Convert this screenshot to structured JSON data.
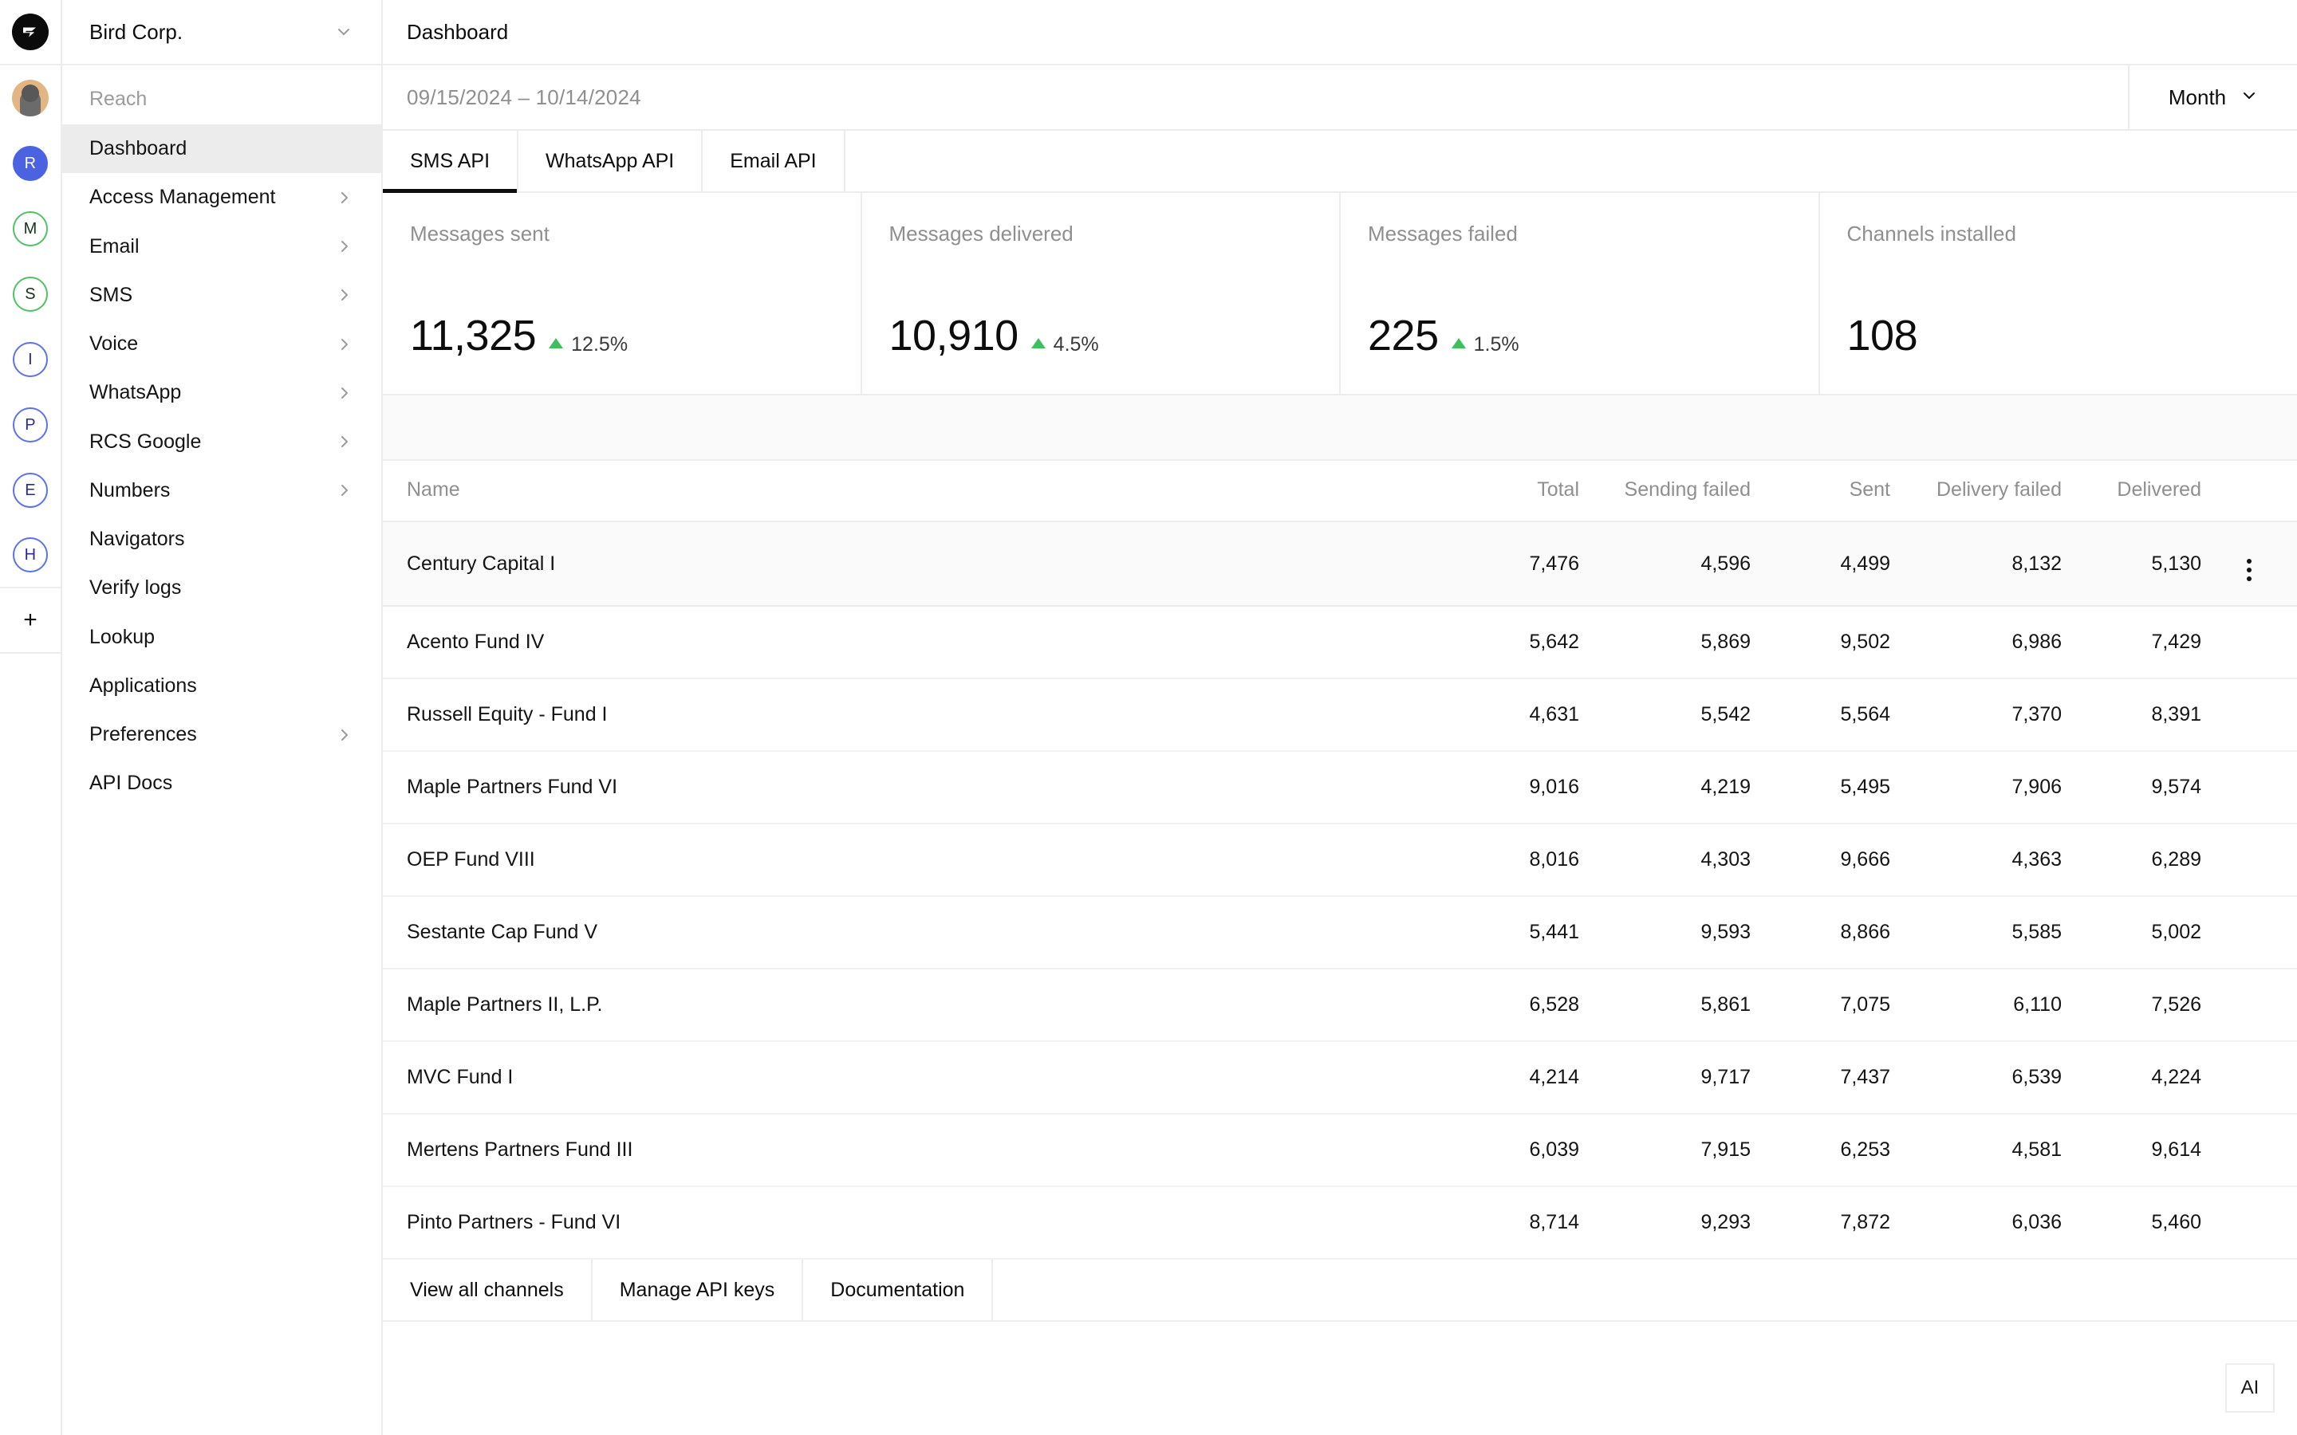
{
  "rail": {
    "logo_icon": "bird-logo-icon",
    "user_avatar_icon": "user-avatar-icon",
    "workspaces": [
      {
        "letter": "R",
        "style": "filled"
      },
      {
        "letter": "M",
        "style": "green"
      },
      {
        "letter": "S",
        "style": "green"
      },
      {
        "letter": "I",
        "style": "blue"
      },
      {
        "letter": "P",
        "style": "blue"
      },
      {
        "letter": "E",
        "style": "blue"
      },
      {
        "letter": "H",
        "style": "blue"
      }
    ],
    "add_label": "+"
  },
  "sidebar": {
    "org_name": "Bird Corp.",
    "section_label": "Reach",
    "items": [
      {
        "label": "Dashboard",
        "expandable": false,
        "active": true
      },
      {
        "label": "Access Management",
        "expandable": true,
        "active": false
      },
      {
        "label": "Email",
        "expandable": true,
        "active": false
      },
      {
        "label": "SMS",
        "expandable": true,
        "active": false
      },
      {
        "label": "Voice",
        "expandable": true,
        "active": false
      },
      {
        "label": "WhatsApp",
        "expandable": true,
        "active": false
      },
      {
        "label": "RCS Google",
        "expandable": true,
        "active": false
      },
      {
        "label": "Numbers",
        "expandable": true,
        "active": false
      },
      {
        "label": "Navigators",
        "expandable": false,
        "active": false
      },
      {
        "label": "Verify logs",
        "expandable": false,
        "active": false
      },
      {
        "label": "Lookup",
        "expandable": false,
        "active": false
      },
      {
        "label": "Applications",
        "expandable": false,
        "active": false
      },
      {
        "label": "Preferences",
        "expandable": true,
        "active": false
      },
      {
        "label": "API Docs",
        "expandable": false,
        "active": false
      }
    ]
  },
  "header": {
    "page_title": "Dashboard",
    "date_range": "09/15/2024 – 10/14/2024",
    "period_value": "Month"
  },
  "tabs": [
    {
      "label": "SMS API",
      "active": true
    },
    {
      "label": "WhatsApp API",
      "active": false
    },
    {
      "label": "Email API",
      "active": false
    }
  ],
  "cards": [
    {
      "label": "Messages sent",
      "value": "11,325",
      "delta": "12.5%",
      "trend": "up",
      "delta_color": "#3fbf5f"
    },
    {
      "label": "Messages delivered",
      "value": "10,910",
      "delta": "4.5%",
      "trend": "up",
      "delta_color": "#3fbf5f"
    },
    {
      "label": "Messages failed",
      "value": "225",
      "delta": "1.5%",
      "trend": "up",
      "delta_color": "#3fbf5f"
    },
    {
      "label": "Channels installed",
      "value": "108",
      "delta": "",
      "trend": "none",
      "delta_color": ""
    }
  ],
  "table": {
    "columns": [
      "Name",
      "Total",
      "Sending failed",
      "Sent",
      "Delivery failed",
      "Delivered"
    ],
    "rows": [
      {
        "name": "Century Capital I",
        "total": "7,476",
        "sending_failed": "4,596",
        "sent": "4,499",
        "delivery_failed": "8,132",
        "delivered": "5,130",
        "highlighted": true,
        "menu": true
      },
      {
        "name": "Acento Fund IV",
        "total": "5,642",
        "sending_failed": "5,869",
        "sent": "9,502",
        "delivery_failed": "6,986",
        "delivered": "7,429",
        "highlighted": false,
        "menu": false
      },
      {
        "name": "Russell Equity - Fund I",
        "total": "4,631",
        "sending_failed": "5,542",
        "sent": "5,564",
        "delivery_failed": "7,370",
        "delivered": "8,391",
        "highlighted": false,
        "menu": false
      },
      {
        "name": "Maple Partners Fund VI",
        "total": "9,016",
        "sending_failed": "4,219",
        "sent": "5,495",
        "delivery_failed": "7,906",
        "delivered": "9,574",
        "highlighted": false,
        "menu": false
      },
      {
        "name": "OEP Fund VIII",
        "total": "8,016",
        "sending_failed": "4,303",
        "sent": "9,666",
        "delivery_failed": "4,363",
        "delivered": "6,289",
        "highlighted": false,
        "menu": false
      },
      {
        "name": "Sestante Cap Fund V",
        "total": "5,441",
        "sending_failed": "9,593",
        "sent": "8,866",
        "delivery_failed": "5,585",
        "delivered": "5,002",
        "highlighted": false,
        "menu": false
      },
      {
        "name": "Maple Partners II, L.P.",
        "total": "6,528",
        "sending_failed": "5,861",
        "sent": "7,075",
        "delivery_failed": "6,110",
        "delivered": "7,526",
        "highlighted": false,
        "menu": false
      },
      {
        "name": "MVC Fund I",
        "total": "4,214",
        "sending_failed": "9,717",
        "sent": "7,437",
        "delivery_failed": "6,539",
        "delivered": "4,224",
        "highlighted": false,
        "menu": false
      },
      {
        "name": "Mertens Partners Fund III",
        "total": "6,039",
        "sending_failed": "7,915",
        "sent": "6,253",
        "delivery_failed": "4,581",
        "delivered": "9,614",
        "highlighted": false,
        "menu": false
      },
      {
        "name": "Pinto Partners - Fund VI",
        "total": "8,714",
        "sending_failed": "9,293",
        "sent": "7,872",
        "delivery_failed": "6,036",
        "delivered": "5,460",
        "highlighted": false,
        "menu": false
      }
    ]
  },
  "footer_actions": [
    {
      "label": "View all channels"
    },
    {
      "label": "Manage API keys"
    },
    {
      "label": "Documentation"
    }
  ],
  "ai_button": {
    "label": "AI"
  }
}
